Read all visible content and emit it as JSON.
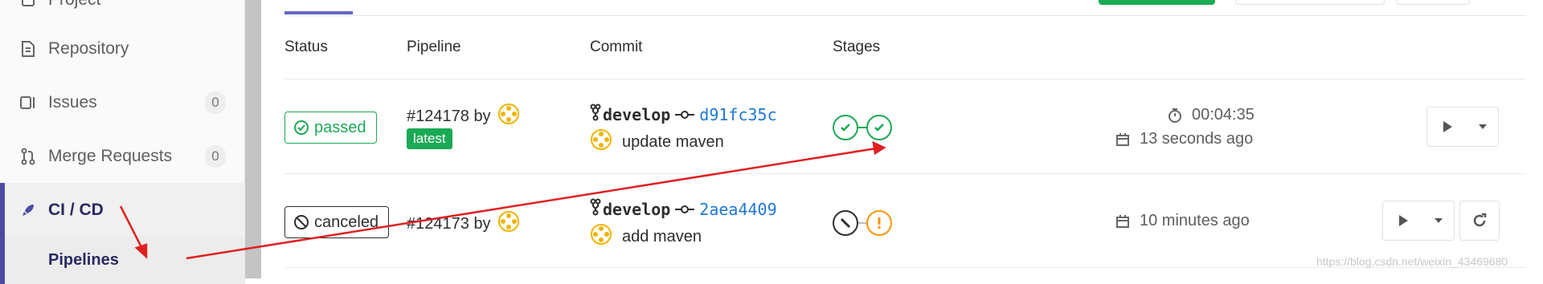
{
  "sidebar": {
    "items": [
      {
        "label": "Project",
        "icon": "project-icon"
      },
      {
        "label": "Repository",
        "icon": "repository-icon"
      },
      {
        "label": "Issues",
        "icon": "issues-icon",
        "count": "0"
      },
      {
        "label": "Merge Requests",
        "icon": "merge-request-icon",
        "count": "0"
      },
      {
        "label": "CI / CD",
        "icon": "rocket-icon"
      }
    ],
    "sub_item": "Pipelines"
  },
  "table": {
    "headers": [
      "Status",
      "Pipeline",
      "Commit",
      "Stages"
    ],
    "rows": [
      {
        "status": "passed",
        "pipeline_id": "#124178",
        "by": "by",
        "tag": "latest",
        "branch": "develop",
        "sha": "d91fc35c",
        "message": "update maven",
        "duration": "00:04:35",
        "finished": "13 seconds ago"
      },
      {
        "status": "canceled",
        "pipeline_id": "#124173",
        "by": "by",
        "branch": "develop",
        "sha": "2aea4409",
        "message": "add maven",
        "finished": "10 minutes ago"
      }
    ]
  },
  "colors": {
    "success": "#1aaa55",
    "warning": "#fc9403",
    "link": "#1f78d1",
    "active_nav": "#4b4ba3",
    "annotation_arrow": "#e02020"
  },
  "watermark": "https://blog.csdn.net/weixin_43469680"
}
